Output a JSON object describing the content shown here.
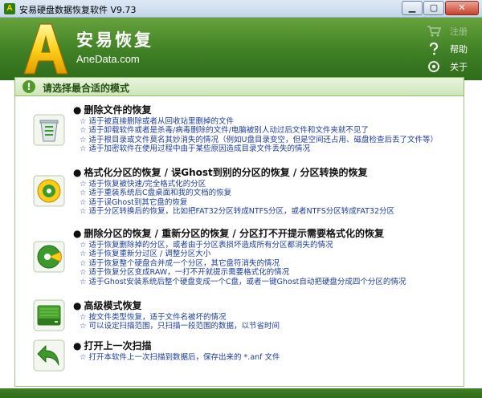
{
  "window": {
    "title": "安易硬盘数据恢复软件 V9.73",
    "app_icon_letter": "A",
    "min_glyph": "▁",
    "max_glyph": "▢",
    "close_glyph": "✕"
  },
  "header": {
    "brand_title": "安易恢复",
    "brand_url": "AneData.com",
    "menu": [
      {
        "label": "注册",
        "icon": "cart-icon",
        "enabled": false
      },
      {
        "label": "帮助",
        "icon": "question-icon",
        "enabled": true
      },
      {
        "label": "关于",
        "icon": "info-circle-icon",
        "enabled": true
      }
    ]
  },
  "banner": {
    "icon_glyph": "!",
    "text": "请选择最合适的模式"
  },
  "options": [
    {
      "title": "删除文件的恢复",
      "icon": "recycle-bin-icon",
      "lines": [
        "适于被直接删除或者从回收站里删掉的文件",
        "适于卸载软件或者是杀毒/病毒删除的文件/电脑被别人动过后文件和文件夹就不见了",
        "适于根目录或文件莫名其妙消失的情况（例如U盘目录变空，但是空间还占用、磁盘检查后丢了文件等）",
        "适于加密软件在使用过程中由于某些原因造成目录文件丢失的情况"
      ]
    },
    {
      "title": "格式化分区的恢复 / 误Ghost到别的分区的恢复 / 分区转换的恢复",
      "icon": "disk-format-icon",
      "lines": [
        "适于恢复被快速/完全格式化的分区",
        "适于重装系统后C盘桌面和我的文档的恢复",
        "适于误Ghost到其它盘的恢复",
        "适于分区转换后的恢复，比如把FAT32分区转成NTFS分区，或者NTFS分区转成FAT32分区"
      ]
    },
    {
      "title": "删除分区的恢复 / 重新分区的恢复 / 分区打不开提示需要格式化的恢复",
      "icon": "partition-icon",
      "lines": [
        "适于恢复删除掉的分区，或者由于分区表损坏造成所有分区都消失的情况",
        "适于恢复重新分过区 / 调整分区大小",
        "适于恢复整个硬盘合并成一个分区，其它盘符消失的情况",
        "适于恢复分区变成RAW，一打不开就提示需要格式化的情况",
        "适于Ghost安装系统后整个硬盘变成一个C盘，或者一键Ghost自动把硬盘分成四个分区的情况"
      ]
    },
    {
      "title": "高级模式恢复",
      "icon": "hard-drive-icon",
      "lines": [
        "按文件类型恢复，适于文件名被坏的情况",
        "可以设定扫描范围，只扫描一段范围的数据，以节省时间"
      ]
    },
    {
      "title": "打开上一次扫描",
      "icon": "back-arrow-icon",
      "lines": [
        "打开本软件上一次扫描到数据后，保存出来的 *.anf 文件"
      ]
    }
  ],
  "bullet_dot": "●",
  "star_glyph": "☆",
  "colors": {
    "header_green": "#3f8025",
    "link_blue": "#1d3c9c",
    "banner_text": "#245010"
  }
}
